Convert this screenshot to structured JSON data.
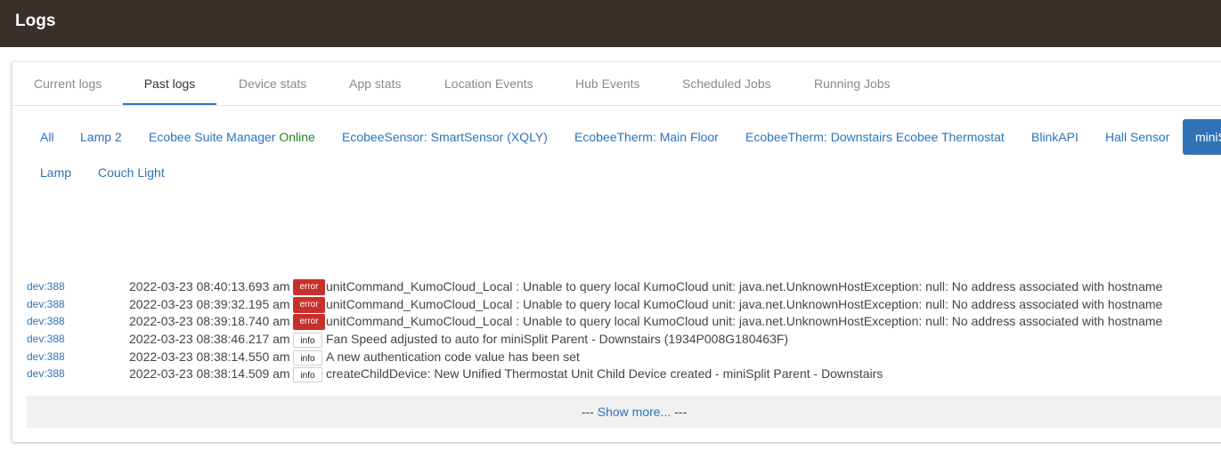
{
  "header": {
    "title": "Logs"
  },
  "tabs": [
    {
      "label": "Current logs"
    },
    {
      "label": "Past logs"
    },
    {
      "label": "Device stats"
    },
    {
      "label": "App stats"
    },
    {
      "label": "Location Events"
    },
    {
      "label": "Hub Events"
    },
    {
      "label": "Scheduled Jobs"
    },
    {
      "label": "Running Jobs"
    }
  ],
  "active_tab": "Past logs",
  "devices": [
    {
      "label": "All"
    },
    {
      "label": "Lamp 2"
    },
    {
      "label": "Ecobee Suite Manager",
      "status": "Online"
    },
    {
      "label": "EcobeeSensor: SmartSensor (XQLY)"
    },
    {
      "label": "EcobeeTherm: Main Floor"
    },
    {
      "label": "EcobeeTherm: Downstairs Ecobee Thermostat"
    },
    {
      "label": "BlinkAPI"
    },
    {
      "label": "Hall Sensor"
    },
    {
      "label": "miniS"
    },
    {
      "label": "Lamp"
    },
    {
      "label": "Couch Light"
    }
  ],
  "logs": [
    {
      "dev": "dev:388",
      "time": "2022-03-23 08:40:13.693 am",
      "level": "error",
      "message": "unitCommand_KumoCloud_Local : Unable to query local KumoCloud unit: java.net.UnknownHostException: null: No address associated with hostname"
    },
    {
      "dev": "dev:388",
      "time": "2022-03-23 08:39:32.195 am",
      "level": "error",
      "message": "unitCommand_KumoCloud_Local : Unable to query local KumoCloud unit: java.net.UnknownHostException: null: No address associated with hostname"
    },
    {
      "dev": "dev:388",
      "time": "2022-03-23 08:39:18.740 am",
      "level": "error",
      "message": "unitCommand_KumoCloud_Local : Unable to query local KumoCloud unit: java.net.UnknownHostException: null: No address associated with hostname"
    },
    {
      "dev": "dev:388",
      "time": "2022-03-23 08:38:46.217 am",
      "level": "info",
      "message": "Fan Speed adjusted to auto for miniSplit Parent - Downstairs (1934P008G180463F)"
    },
    {
      "dev": "dev:388",
      "time": "2022-03-23 08:38:14.550 am",
      "level": "info",
      "message": "A new authentication code value has been set"
    },
    {
      "dev": "dev:388",
      "time": "2022-03-23 08:38:14.509 am",
      "level": "info",
      "message": "createChildDevice: New Unified Thermostat Unit Child Device created -  miniSplit Parent - Downstairs"
    }
  ],
  "show_more": {
    "prefix": "--- ",
    "link": "Show more...",
    "suffix": " ---"
  },
  "colors": {
    "header_bg": "#3b2f2a",
    "accent": "#2b74b8",
    "error": "#c9302c",
    "online": "#1e8a1e"
  }
}
